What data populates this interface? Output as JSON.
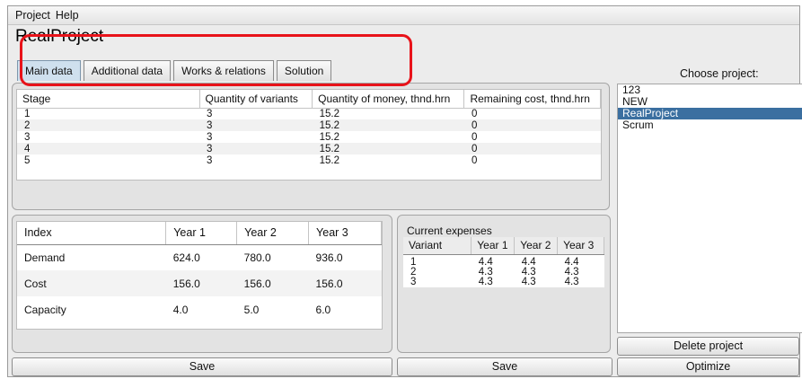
{
  "menu": {
    "items": [
      "Project",
      "Help"
    ]
  },
  "project_title": "RealProject",
  "tabs": [
    "Main data",
    "Additional data",
    "Works & relations",
    "Solution"
  ],
  "stage_table": {
    "headers": [
      "Stage",
      "Quantity of variants",
      "Quantity of money, thnd.hrn",
      "Remaining cost, thnd.hrn"
    ],
    "rows": [
      [
        "1",
        "3",
        "15.2",
        "0"
      ],
      [
        "2",
        "3",
        "15.2",
        "0"
      ],
      [
        "3",
        "3",
        "15.2",
        "0"
      ],
      [
        "4",
        "3",
        "15.2",
        "0"
      ],
      [
        "5",
        "3",
        "15.2",
        "0"
      ]
    ]
  },
  "index_table": {
    "headers": [
      "Index",
      "Year 1",
      "Year 2",
      "Year 3"
    ],
    "rows": [
      [
        "Demand",
        "624.0",
        "780.0",
        "936.0"
      ],
      [
        "Cost",
        "156.0",
        "156.0",
        "156.0"
      ],
      [
        "Capacity",
        "4.0",
        "5.0",
        "6.0"
      ]
    ]
  },
  "expenses": {
    "title": "Current expenses",
    "headers": [
      "Variant",
      "Year 1",
      "Year 2",
      "Year 3"
    ],
    "rows": [
      [
        "1",
        "4.4",
        "4.4",
        "4.4"
      ],
      [
        "2",
        "4.3",
        "4.3",
        "4.3"
      ],
      [
        "3",
        "4.3",
        "4.3",
        "4.3"
      ]
    ]
  },
  "projects": {
    "label": "Choose project:",
    "items": [
      "123",
      "NEW",
      "RealProject",
      "Scrum"
    ],
    "selected": "RealProject"
  },
  "buttons": {
    "save_left": "Save",
    "save_right": "Save",
    "delete_project": "Delete project",
    "optimize": "Optimize"
  },
  "colors": {
    "selection": "#3b6fa0",
    "highlight_outline": "#e8131a",
    "active_tab": "#cfe0ee"
  }
}
